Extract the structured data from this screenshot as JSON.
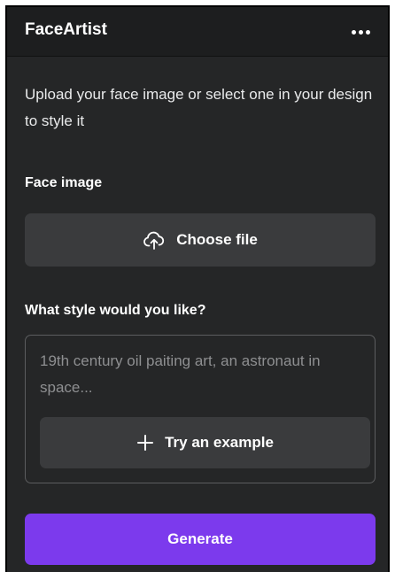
{
  "app": {
    "title": "FaceArtist",
    "menu_icon": "more-horizontal-icon"
  },
  "description": "Upload your face image or select one in your design to style it",
  "face_image": {
    "label": "Face image",
    "choose_file_label": "Choose file",
    "upload_icon": "cloud-upload-icon"
  },
  "style": {
    "label": "What style would you like?",
    "placeholder": "19th century oil paiting art, an astronaut in space...",
    "try_example_label": "Try an example",
    "plus_icon": "plus-icon"
  },
  "generate_label": "Generate",
  "colors": {
    "panel_bg": "#252627",
    "header_bg": "#1d1e1f",
    "button_bg": "#3a3b3d",
    "accent": "#7c3aed"
  }
}
